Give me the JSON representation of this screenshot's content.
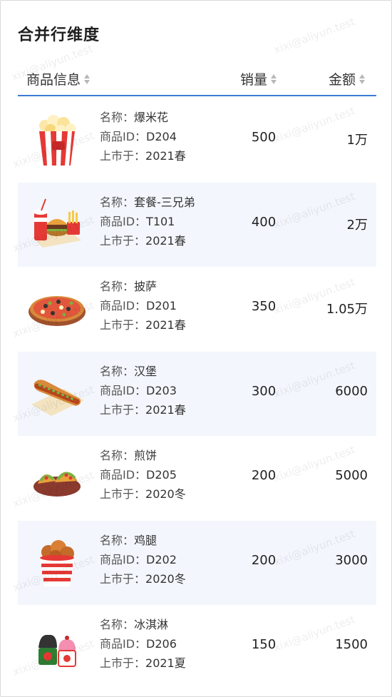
{
  "title": "合并行维度",
  "columns": {
    "product": "商品信息",
    "sales": "销量",
    "amount": "金额"
  },
  "labels": {
    "name": "名称：",
    "id": "商品ID：",
    "launch": "上市于："
  },
  "watermark": "xixi@aliyun.test",
  "rows": [
    {
      "name": "爆米花",
      "id": "D204",
      "launch": "2021春",
      "sales": "500",
      "amount": "1万",
      "icon": "popcorn-icon"
    },
    {
      "name": "套餐-三兄弟",
      "id": "T101",
      "launch": "2021春",
      "sales": "400",
      "amount": "2万",
      "icon": "combo-meal-icon"
    },
    {
      "name": "披萨",
      "id": "D201",
      "launch": "2021春",
      "sales": "350",
      "amount": "1.05万",
      "icon": "pizza-icon"
    },
    {
      "name": "汉堡",
      "id": "D203",
      "launch": "2021春",
      "sales": "300",
      "amount": "6000",
      "icon": "hotdog-icon"
    },
    {
      "name": "煎饼",
      "id": "D205",
      "launch": "2020冬",
      "sales": "200",
      "amount": "5000",
      "icon": "taco-icon"
    },
    {
      "name": "鸡腿",
      "id": "D202",
      "launch": "2020冬",
      "sales": "200",
      "amount": "3000",
      "icon": "fried-chicken-icon"
    },
    {
      "name": "冰淇淋",
      "id": "D206",
      "launch": "2021夏",
      "sales": "150",
      "amount": "1500",
      "icon": "ice-cream-icon"
    }
  ]
}
